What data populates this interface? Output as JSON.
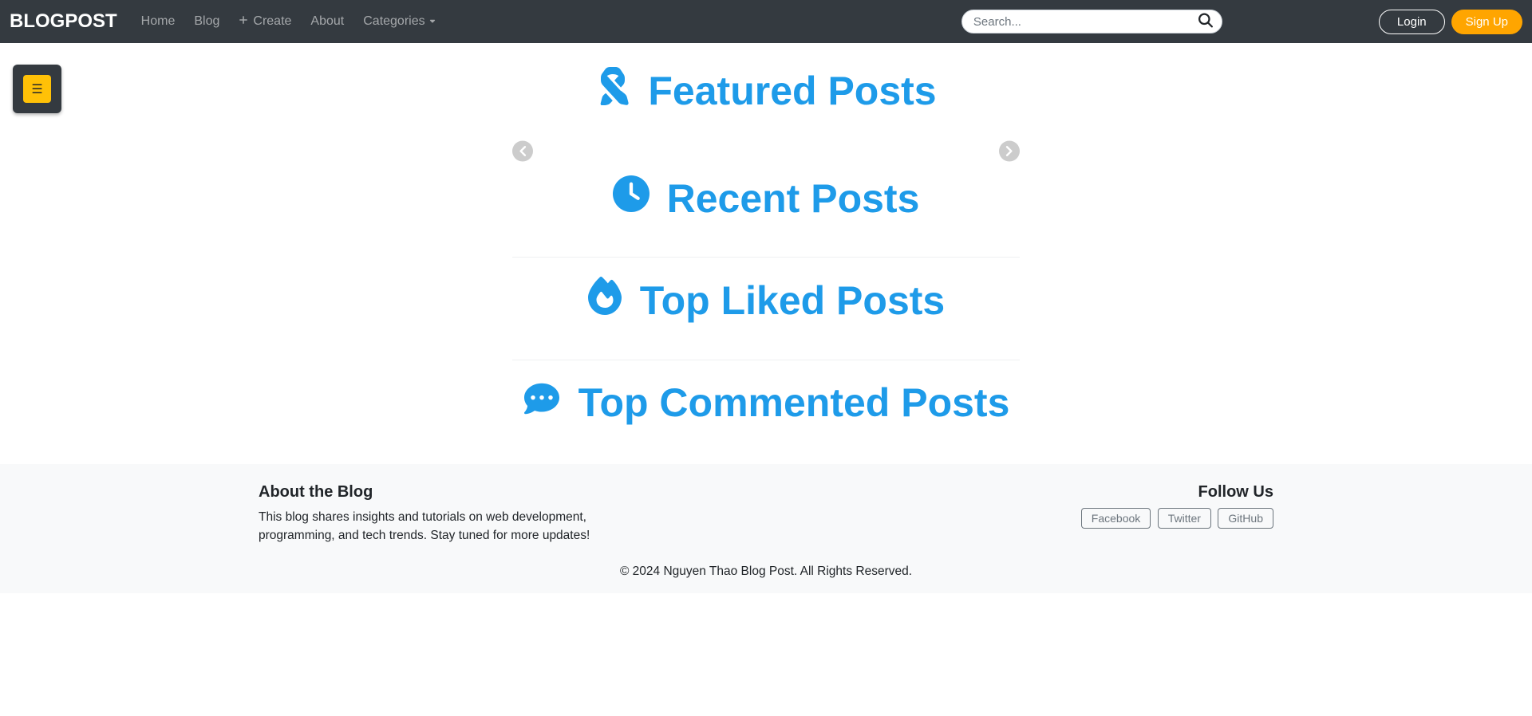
{
  "nav": {
    "brand": "BLOGPOST",
    "home": "Home",
    "blog": "Blog",
    "create": "Create",
    "about": "About",
    "categories": "Categories"
  },
  "search": {
    "placeholder": "Search..."
  },
  "auth": {
    "login": "Login",
    "signup": "Sign Up"
  },
  "sidebar": {
    "toggle_glyph": "☰"
  },
  "sections": {
    "featured": "Featured Posts",
    "recent": "Recent Posts",
    "liked": "Top Liked Posts",
    "commented": "Top Commented Posts"
  },
  "footer": {
    "about_h": "About the Blog",
    "about_p": "This blog shares insights and tutorials on web development, programming, and tech trends. Stay tuned for more updates!",
    "follow_h": "Follow Us",
    "social": {
      "fb": "Facebook",
      "tw": "Twitter",
      "gh": "GitHub"
    },
    "copyright": "© 2024 Nguyen Thao Blog Post. All Rights Reserved."
  }
}
